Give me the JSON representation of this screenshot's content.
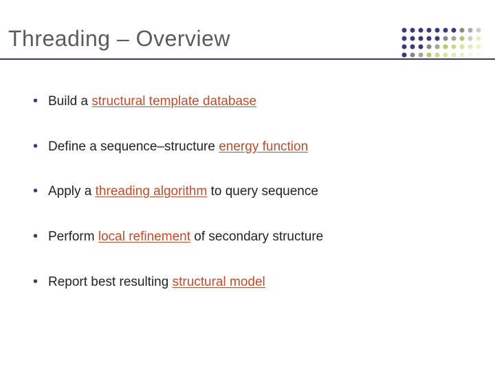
{
  "title": "Threading – Overview",
  "bullets": [
    {
      "pre": "Build a ",
      "term": "structural template database",
      "post": ""
    },
    {
      "pre": "Define a sequence–structure ",
      "term": "energy function",
      "post": ""
    },
    {
      "pre": "Apply a ",
      "term": "threading algorithm",
      "post": " to query sequence"
    },
    {
      "pre": "Perform ",
      "term": "local refinement",
      "post": " of secondary structure"
    },
    {
      "pre": "Report best resulting ",
      "term": "structural model",
      "post": ""
    }
  ]
}
